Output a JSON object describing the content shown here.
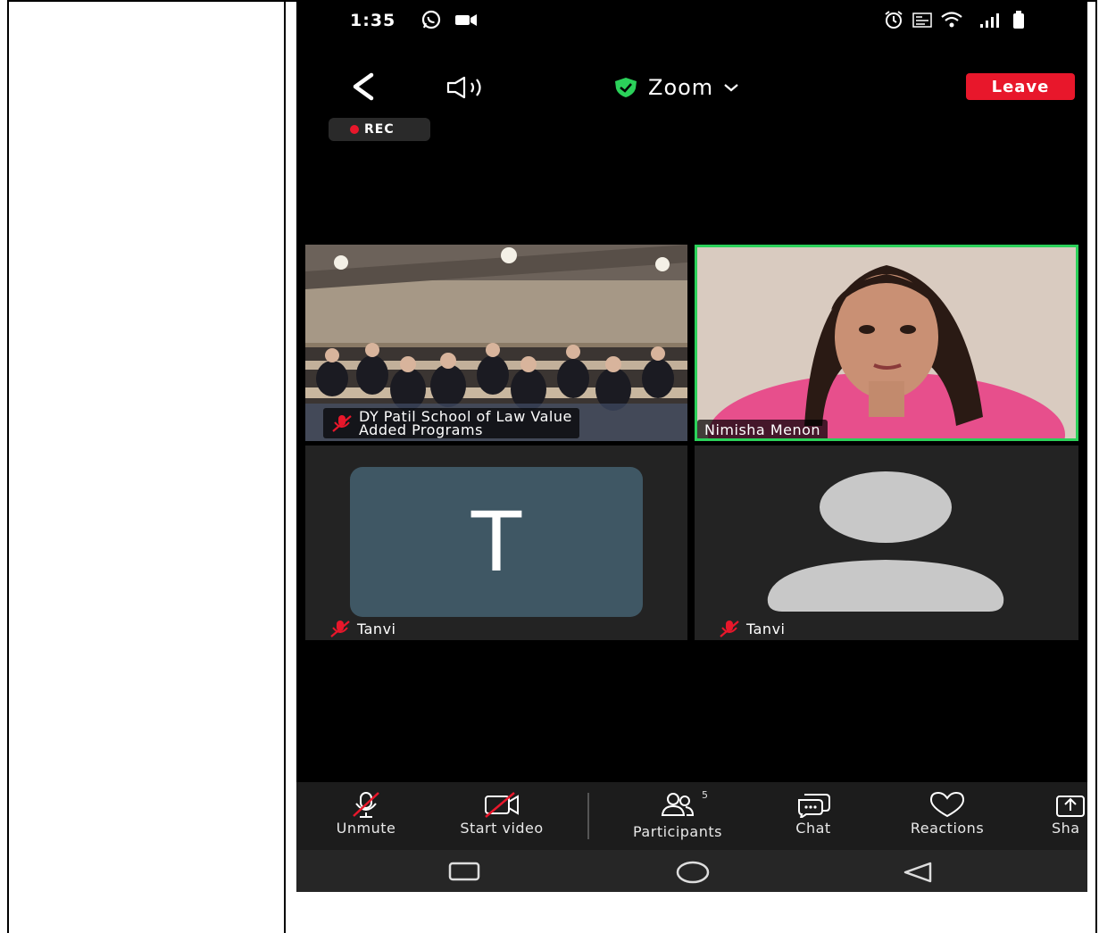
{
  "statusbar": {
    "time": "1:35"
  },
  "header": {
    "title": "Zoom",
    "leave_label": "Leave",
    "rec_label": "REC"
  },
  "tiles": [
    {
      "name_line1": "DY Patil School of Law Value",
      "name_line2": "Added Programs",
      "muted": true
    },
    {
      "name": "Nimisha Menon",
      "active_speaker": true
    },
    {
      "avatar_letter": "T",
      "name": "Tanvi",
      "muted": true
    },
    {
      "name": "Tanvi",
      "muted": true
    }
  ],
  "toolbar": {
    "unmute": "Unmute",
    "start_video": "Start video",
    "participants": "Participants",
    "participants_count": "5",
    "chat": "Chat",
    "reactions": "Reactions",
    "share": "Sha"
  },
  "colors": {
    "leave": "#e8172b",
    "active_border": "#2bd15a",
    "shield": "#2bd15a",
    "avatar_bg": "#3f5764"
  }
}
